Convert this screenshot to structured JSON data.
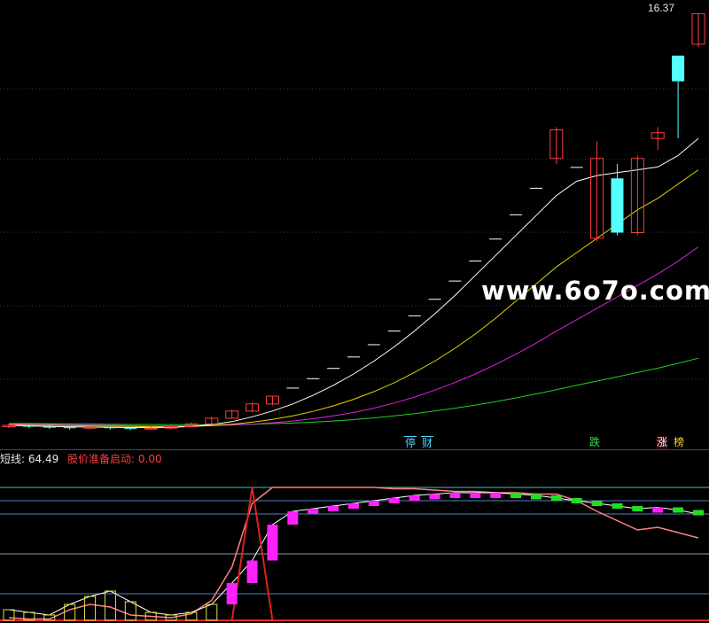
{
  "price_panel": {
    "top_price_label": "16.37",
    "tags": [
      {
        "text": "停",
        "style": "cyan"
      },
      {
        "text": "财",
        "style": "cyan"
      },
      {
        "text": "跌",
        "style": "green"
      },
      {
        "text": "涨",
        "style": "redbox"
      },
      {
        "text": "榜",
        "style": "yellowbox"
      }
    ]
  },
  "indicator_panel": {
    "legend_line": "短线: 64.49",
    "legend_start": "股价准备启动: 0.00"
  },
  "watermark": "www.6o7o.com",
  "chart_data": [
    {
      "type": "candlestick",
      "title": "",
      "candles": [
        {
          "o": 1.9,
          "c": 1.95,
          "h": 2.0,
          "l": 1.85
        },
        {
          "o": 1.95,
          "c": 1.9,
          "h": 2.0,
          "l": 1.85
        },
        {
          "o": 1.9,
          "c": 1.88,
          "h": 1.95,
          "l": 1.82
        },
        {
          "o": 1.88,
          "c": 1.85,
          "h": 1.92,
          "l": 1.8
        },
        {
          "o": 1.85,
          "c": 1.88,
          "h": 1.92,
          "l": 1.8
        },
        {
          "o": 1.88,
          "c": 1.85,
          "h": 1.9,
          "l": 1.8
        },
        {
          "o": 1.85,
          "c": 1.82,
          "h": 1.88,
          "l": 1.78
        },
        {
          "o": 1.82,
          "c": 1.85,
          "h": 1.9,
          "l": 1.78
        },
        {
          "o": 1.85,
          "c": 1.9,
          "h": 1.95,
          "l": 1.8
        },
        {
          "o": 1.9,
          "c": 2.0,
          "h": 2.05,
          "l": 1.88
        },
        {
          "o": 2.0,
          "c": 2.2,
          "h": 2.25,
          "l": 1.98
        },
        {
          "o": 2.2,
          "c": 2.45,
          "h": 2.5,
          "l": 2.18
        },
        {
          "o": 2.45,
          "c": 2.7,
          "h": 2.75,
          "l": 2.4
        },
        {
          "o": 2.7,
          "c": 2.97,
          "h": 2.97,
          "l": 2.65
        },
        {
          "o": 3.27,
          "c": 3.27,
          "h": 3.27,
          "l": 3.27
        },
        {
          "o": 3.6,
          "c": 3.6,
          "h": 3.6,
          "l": 3.6
        },
        {
          "o": 3.96,
          "c": 3.96,
          "h": 3.96,
          "l": 3.96
        },
        {
          "o": 4.36,
          "c": 4.36,
          "h": 4.36,
          "l": 4.36
        },
        {
          "o": 4.79,
          "c": 4.79,
          "h": 4.79,
          "l": 4.79
        },
        {
          "o": 5.27,
          "c": 5.27,
          "h": 5.27,
          "l": 5.27
        },
        {
          "o": 5.8,
          "c": 5.8,
          "h": 5.8,
          "l": 5.8
        },
        {
          "o": 6.38,
          "c": 6.38,
          "h": 6.38,
          "l": 6.38
        },
        {
          "o": 7.02,
          "c": 7.02,
          "h": 7.02,
          "l": 7.02
        },
        {
          "o": 7.72,
          "c": 7.72,
          "h": 7.72,
          "l": 7.72
        },
        {
          "o": 8.49,
          "c": 8.49,
          "h": 8.49,
          "l": 8.49
        },
        {
          "o": 9.34,
          "c": 9.34,
          "h": 9.34,
          "l": 9.34
        },
        {
          "o": 10.27,
          "c": 10.27,
          "h": 10.27,
          "l": 10.27
        },
        {
          "o": 11.3,
          "c": 12.3,
          "h": 12.4,
          "l": 11.1
        },
        {
          "o": 11.0,
          "c": 11.0,
          "h": 11.0,
          "l": 11.0
        },
        {
          "o": 8.5,
          "c": 11.3,
          "h": 11.9,
          "l": 8.4
        },
        {
          "o": 10.6,
          "c": 8.7,
          "h": 11.1,
          "l": 8.6
        },
        {
          "o": 8.7,
          "c": 11.3,
          "h": 11.4,
          "l": 8.6
        },
        {
          "o": 12.0,
          "c": 12.2,
          "h": 12.4,
          "l": 11.6
        },
        {
          "o": 14.9,
          "c": 14.0,
          "h": 14.9,
          "l": 12.0
        },
        {
          "o": 15.3,
          "c": 16.37,
          "h": 16.37,
          "l": 15.2
        }
      ],
      "ma_white": [
        1.95,
        1.93,
        1.91,
        1.9,
        1.89,
        1.88,
        1.87,
        1.87,
        1.88,
        1.91,
        1.98,
        2.08,
        2.25,
        2.45,
        2.7,
        3.0,
        3.35,
        3.75,
        4.2,
        4.7,
        5.25,
        5.85,
        6.5,
        7.2,
        7.9,
        8.6,
        9.3,
        10.0,
        10.5,
        10.7,
        10.8,
        10.9,
        11.0,
        11.4,
        12.0
      ],
      "ma_yellow": [
        1.97,
        1.96,
        1.95,
        1.94,
        1.93,
        1.92,
        1.91,
        1.9,
        1.9,
        1.91,
        1.94,
        1.99,
        2.06,
        2.16,
        2.28,
        2.44,
        2.63,
        2.86,
        3.13,
        3.44,
        3.8,
        4.2,
        4.65,
        5.15,
        5.7,
        6.3,
        6.9,
        7.5,
        8.0,
        8.5,
        9.0,
        9.5,
        9.9,
        10.4,
        10.9
      ],
      "ma_magenta": [
        2.0,
        1.99,
        1.98,
        1.97,
        1.96,
        1.95,
        1.94,
        1.93,
        1.93,
        1.93,
        1.94,
        1.96,
        1.99,
        2.04,
        2.1,
        2.18,
        2.28,
        2.4,
        2.55,
        2.73,
        2.94,
        3.18,
        3.45,
        3.75,
        4.08,
        4.44,
        4.83,
        5.25,
        5.65,
        6.05,
        6.45,
        6.85,
        7.25,
        7.7,
        8.2
      ],
      "ma_green": [
        2.02,
        2.02,
        2.01,
        2.0,
        2.0,
        1.99,
        1.98,
        1.98,
        1.97,
        1.97,
        1.97,
        1.98,
        1.99,
        2.01,
        2.03,
        2.06,
        2.1,
        2.15,
        2.21,
        2.28,
        2.36,
        2.45,
        2.55,
        2.66,
        2.78,
        2.91,
        3.05,
        3.2,
        3.35,
        3.5,
        3.65,
        3.8,
        3.95,
        4.12,
        4.3
      ],
      "ylim": [
        1.7,
        16.6
      ],
      "grid": true,
      "colors": {
        "up": "#ff3b3b",
        "down": "#54ffff",
        "flat": "#ffffff",
        "ma_white": "#ffffff",
        "ma_yellow": "#e6d200",
        "ma_magenta": "#e020e0",
        "ma_green": "#20d020"
      }
    },
    {
      "type": "indicator",
      "series_short": [
        8,
        6,
        4,
        12,
        18,
        22,
        14,
        6,
        4,
        6,
        12,
        28,
        45,
        72,
        82,
        84,
        86,
        88,
        90,
        92,
        94,
        95,
        96,
        96,
        96,
        95,
        94,
        92,
        90,
        88,
        86,
        84,
        85,
        83,
        80
      ],
      "series_pink": [
        2,
        1,
        1,
        8,
        12,
        10,
        4,
        3,
        2,
        5,
        15,
        40,
        88,
        100,
        100,
        100,
        100,
        100,
        100,
        99,
        99,
        98,
        97,
        97,
        96,
        96,
        95,
        95,
        90,
        82,
        75,
        68,
        70,
        66,
        62
      ],
      "peak_line": [
        0,
        0,
        0,
        0,
        0,
        0,
        0,
        0,
        0,
        0,
        0,
        0,
        100,
        0,
        0,
        0,
        0,
        0,
        0,
        0,
        0,
        0,
        0,
        0,
        0,
        0,
        0,
        0,
        0,
        0,
        0,
        0,
        0,
        0,
        0
      ],
      "ylim": [
        0,
        100
      ],
      "levels": [
        20,
        50,
        80,
        90,
        100
      ]
    }
  ]
}
